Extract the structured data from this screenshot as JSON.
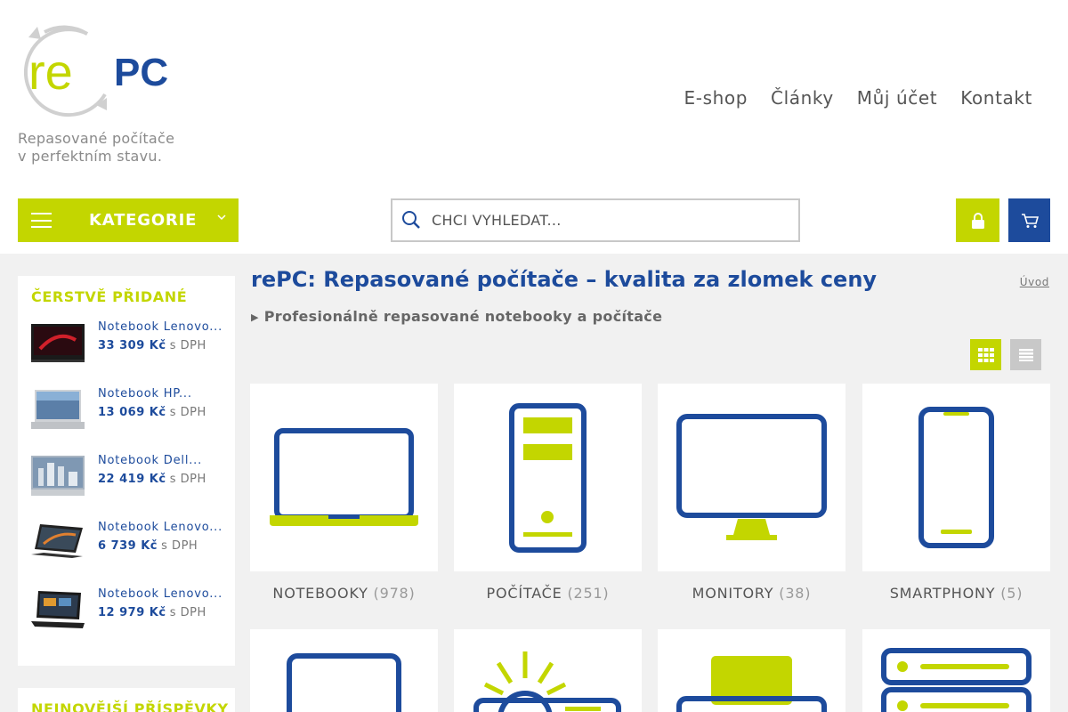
{
  "brand": {
    "logo_text_re": "re",
    "logo_text_pc": "PC",
    "tagline_line1": "Repasované počítače",
    "tagline_line2": "v perfektním stavu."
  },
  "nav": [
    "E-shop",
    "Články",
    "Můj účet",
    "Kontakt"
  ],
  "kategorie_label": "KATEGORIE",
  "search": {
    "placeholder": "CHCI VYHLEDAT..."
  },
  "sidebar": {
    "title": "ČERSTVĚ PŘIDANÉ",
    "items": [
      {
        "name": "Notebook Lenovo...",
        "price": "33 309 Kč",
        "suffix": "s DPH"
      },
      {
        "name": "Notebook HP...",
        "price": "13 069 Kč",
        "suffix": "s DPH"
      },
      {
        "name": "Notebook Dell...",
        "price": "22 419 Kč",
        "suffix": "s DPH"
      },
      {
        "name": "Notebook Lenovo...",
        "price": "6 739 Kč",
        "suffix": "s DPH"
      },
      {
        "name": "Notebook Lenovo...",
        "price": "12 979 Kč",
        "suffix": "s DPH"
      }
    ],
    "title2": "NEJNOVĚJŠÍ PŘÍSPĚVKY"
  },
  "main": {
    "title": "rePC: Repasované počítače – kvalita za zlomek ceny",
    "breadcrumb": "Úvod",
    "subtitle": "Profesionálně repasované notebooky a počítače"
  },
  "categories": [
    {
      "name": "NOTEBOOKY",
      "count": "(978)",
      "icon": "laptop-icon"
    },
    {
      "name": "POČÍTAČE",
      "count": "(251)",
      "icon": "desktop-tower-icon"
    },
    {
      "name": "MONITORY",
      "count": "(38)",
      "icon": "monitor-icon"
    },
    {
      "name": "SMARTPHONY",
      "count": "(5)",
      "icon": "smartphone-icon"
    }
  ],
  "colors": {
    "accent": "#c3d600",
    "brand_blue": "#1d4b9c"
  }
}
